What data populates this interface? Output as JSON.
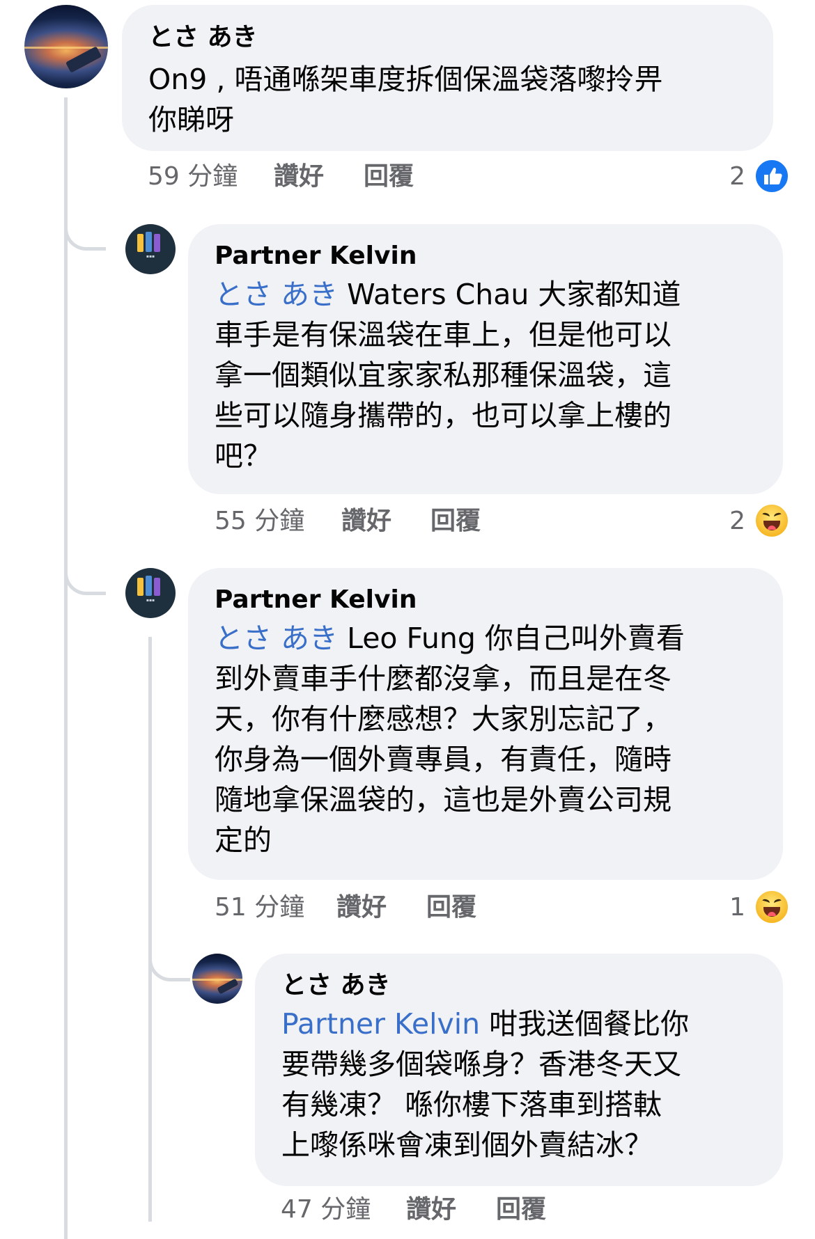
{
  "comments": [
    {
      "author": "とさ あき",
      "avatar": "sunset-plane-wing-avatar",
      "lines": [
        "On9 , 唔通喺架車度拆個保溫袋落嚟拎畀",
        "你睇呀"
      ],
      "time": "59 分鐘",
      "like_label": "讚好",
      "reply_label": "回覆",
      "reaction_count": "2",
      "reaction": "like-icon"
    },
    {
      "author": "Partner Kelvin",
      "avatar": "brand-logo-avatar",
      "mention": "とさ あき",
      "lines": [
        " Waters Chau 大家都知道",
        "車手是有保溫袋在車上，但是他可以",
        "拿一個類似宜家家私那種保溫袋，這",
        "些可以隨身攜帶的，也可以拿上樓的",
        "吧？"
      ],
      "time": "55 分鐘",
      "like_label": "讚好",
      "reply_label": "回覆",
      "reaction_count": "2",
      "reaction": "haha-icon"
    },
    {
      "author": "Partner Kelvin",
      "avatar": "brand-logo-avatar",
      "mention": "とさ あき",
      "lines": [
        " Leo Fung 你自己叫外賣看",
        "到外賣車手什麼都沒拿，而且是在冬",
        "天，你有什麼感想？大家別忘記了，",
        "你身為一個外賣專員，有責任，隨時",
        "隨地拿保溫袋的，這也是外賣公司規",
        "定的"
      ],
      "time": "51 分鐘",
      "like_label": "讚好",
      "reply_label": "回覆",
      "reaction_count": "1",
      "reaction": "haha-icon"
    },
    {
      "author": "とさ あき",
      "avatar": "sunset-plane-wing-avatar",
      "mention": "Partner Kelvin",
      "lines": [
        " 咁我送個餐比你",
        "要帶幾多個袋喺身？香港冬天又",
        "有幾凍？ 喺你樓下落車到搭軚",
        "上嚟係咪會凍到個外賣結冰？"
      ],
      "time": "47 分鐘",
      "like_label": "讚好",
      "reply_label": "回覆"
    }
  ],
  "colors": {
    "bubble": "#f0f2f5",
    "mention": "#3a6fc9",
    "meta": "#65676b",
    "like": "#1877f2",
    "thread_line": "#d8dbe0"
  }
}
